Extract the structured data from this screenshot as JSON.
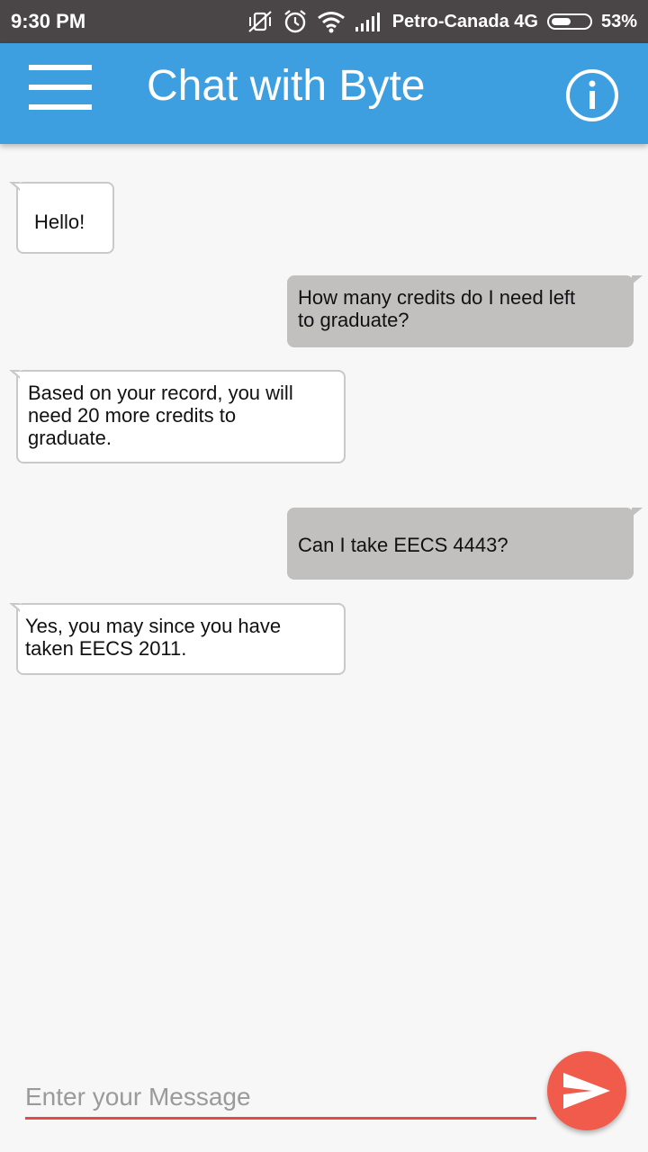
{
  "status_bar": {
    "time": "9:30 PM",
    "carrier": "Petro-Canada 4G",
    "battery_percent": "53%",
    "battery_level": 0.53,
    "icons": [
      "vibrate-off-icon",
      "alarm-icon",
      "wifi-icon",
      "signal-icon",
      "battery-icon"
    ]
  },
  "app_bar": {
    "title": "Chat with Byte",
    "menu_icon": "hamburger-menu-icon",
    "info_icon": "info-icon",
    "background": "#3d9fe0"
  },
  "messages": [
    {
      "from": "bot",
      "text": "Hello!"
    },
    {
      "from": "user",
      "text": "How many credits do I need left\nto graduate?"
    },
    {
      "from": "bot",
      "text": "Based on your record, you will\nneed 20 more credits to\ngraduate."
    },
    {
      "from": "user",
      "text": "Can I take EECS 4443?"
    },
    {
      "from": "bot",
      "text": "Yes, you may since you have\ntaken EECS 2011."
    }
  ],
  "composer": {
    "placeholder": "Enter your Message",
    "value": "",
    "send_icon": "send-icon",
    "accent": "#f05b4c"
  }
}
